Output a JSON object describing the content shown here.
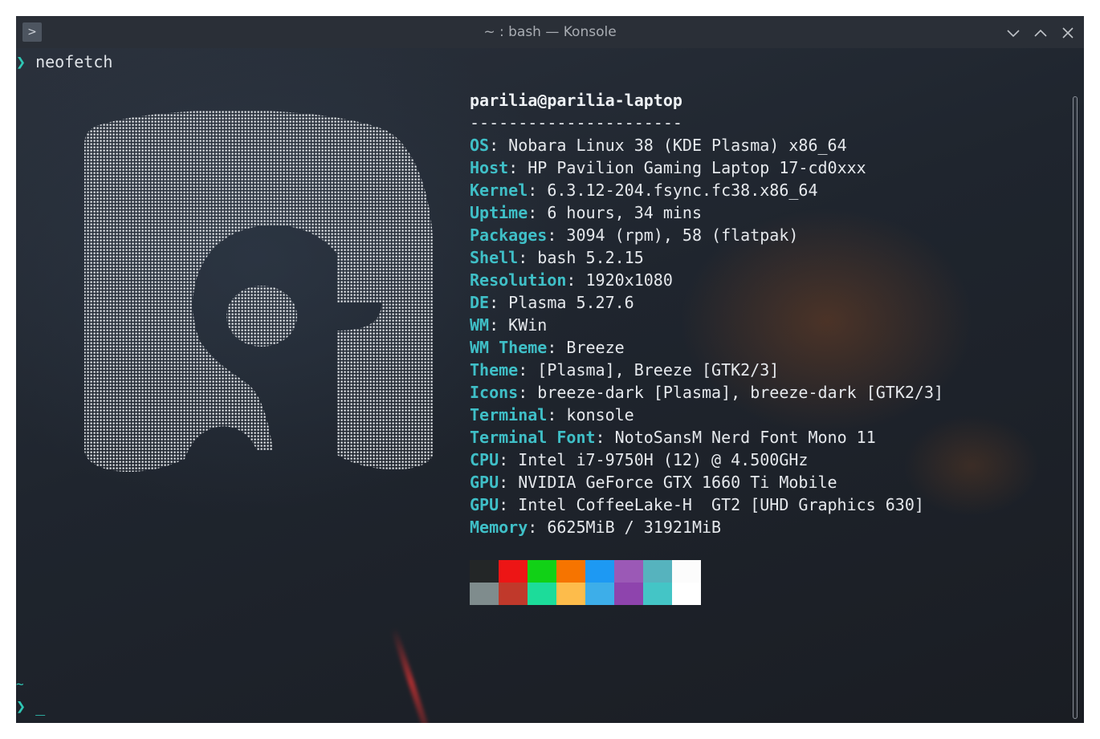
{
  "window": {
    "title": "~ : bash — Konsole",
    "app_icon_glyph": ">",
    "buttons": {
      "minimize": "chevron-down-icon",
      "maximize": "chevron-up-icon",
      "close": "close-icon"
    }
  },
  "terminal": {
    "prompt_symbol": "❯",
    "command": "neofetch",
    "tilde_line": "~",
    "cursor": "_",
    "user_host": "parilia@parilia-laptop",
    "separator": "----------------------",
    "info": [
      {
        "key": "OS",
        "value": ": Nobara Linux 38 (KDE Plasma) x86_64"
      },
      {
        "key": "Host",
        "value": ": HP Pavilion Gaming Laptop 17-cd0xxx"
      },
      {
        "key": "Kernel",
        "value": ": 6.3.12-204.fsync.fc38.x86_64"
      },
      {
        "key": "Uptime",
        "value": ": 6 hours, 34 mins"
      },
      {
        "key": "Packages",
        "value": ": 3094 (rpm), 58 (flatpak)"
      },
      {
        "key": "Shell",
        "value": ": bash 5.2.15"
      },
      {
        "key": "Resolution",
        "value": ": 1920x1080"
      },
      {
        "key": "DE",
        "value": ": Plasma 5.27.6"
      },
      {
        "key": "WM",
        "value": ": KWin"
      },
      {
        "key": "WM Theme",
        "value": ": Breeze"
      },
      {
        "key": "Theme",
        "value": ": [Plasma], Breeze [GTK2/3]"
      },
      {
        "key": "Icons",
        "value": ": breeze-dark [Plasma], breeze-dark [GTK2/3]"
      },
      {
        "key": "Terminal",
        "value": ": konsole"
      },
      {
        "key": "Terminal Font",
        "value": ": NotoSansM Nerd Font Mono 11"
      },
      {
        "key": "CPU",
        "value": ": Intel i7-9750H (12) @ 4.500GHz"
      },
      {
        "key": "GPU",
        "value": ": NVIDIA GeForce GTX 1660 Ti Mobile"
      },
      {
        "key": "GPU",
        "value": ": Intel CoffeeLake-H  GT2 [UHD Graphics 630]"
      },
      {
        "key": "Memory",
        "value": ": 6625MiB / 31921MiB"
      }
    ],
    "palette_colors": [
      "#232627",
      "#ed1515",
      "#11d116",
      "#f67400",
      "#1d99f3",
      "#9b59b6",
      "#56b3be",
      "#fcfcfc",
      "#7f8c8d",
      "#c0392b",
      "#1cdc9a",
      "#fdbc4b",
      "#3daee9",
      "#8e44ad",
      "#44c5c6",
      "#ffffff"
    ],
    "logo_description": "nobara-logo-ascii"
  }
}
